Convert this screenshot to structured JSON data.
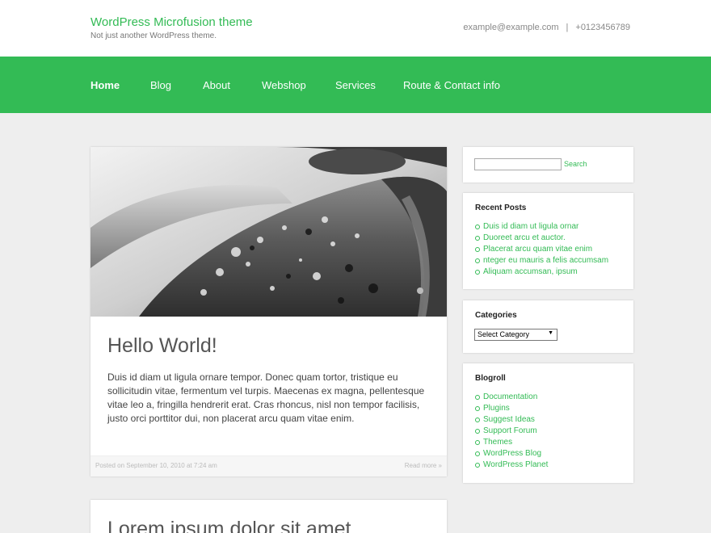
{
  "header": {
    "site_title": "WordPress Microfusion theme",
    "site_description": "Not just another WordPress theme.",
    "email": "example@example.com",
    "separator": "|",
    "phone": "+0123456789"
  },
  "nav": {
    "items": [
      {
        "label": "Home",
        "active": true
      },
      {
        "label": "Blog"
      },
      {
        "label": "About"
      },
      {
        "label": "Webshop"
      },
      {
        "label": "Services"
      },
      {
        "label": "Route & Contact info"
      }
    ]
  },
  "posts": [
    {
      "title": "Hello World!",
      "body": "Duis id diam ut ligula ornare tempor. Donec quam tortor, tristique eu sollicitudin vitae, fermentum vel turpis. Maecenas ex magna, pellentesque vitae leo a, fringilla hendrerit erat. Cras rhoncus, nisl non tempor facilisis, justo orci porttitor dui, non placerat arcu quam vitae enim.",
      "meta": "Posted on September 10, 2010 at 7:24 am",
      "read_more": "Read more »"
    },
    {
      "title": "Lorem ipsum dolor sit amet"
    }
  ],
  "sidebar": {
    "search": {
      "button_label": "Search",
      "value": ""
    },
    "recent_posts": {
      "title": "Recent Posts",
      "items": [
        "Duis id diam ut ligula ornar",
        "Duoreet arcu et auctor.",
        "Placerat arcu quam vitae enim",
        "nteger eu mauris a felis accumsam",
        "Aliquam accumsan, ipsum"
      ]
    },
    "categories": {
      "title": "Categories",
      "selected": "Select Category",
      "arrow": "▼"
    },
    "blogroll": {
      "title": "Blogroll",
      "items": [
        "Documentation",
        "Plugins",
        "Suggest Ideas",
        "Support Forum",
        "Themes",
        "WordPress Blog",
        "WordPress Planet"
      ]
    }
  },
  "colors": {
    "accent": "#33bb55",
    "background": "#eeeeee"
  }
}
